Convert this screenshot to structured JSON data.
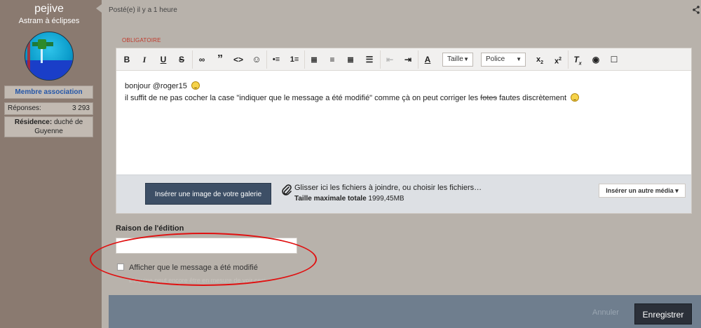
{
  "user": {
    "name": "pejive",
    "title": "Astram à éclipses",
    "badge": "Membre association",
    "replies_label": "Réponses:",
    "replies_value": "3 293",
    "residence_label": "Résidence:",
    "residence_value": "duché de Guyenne"
  },
  "post": {
    "meta": "Posté(e) il y a 1 heure"
  },
  "editor": {
    "required_label": "OBLIGATOIRE",
    "toolbar": {
      "size_select": "Taille",
      "font_select": "Police"
    },
    "content": {
      "line1": "bonjour @roger15",
      "line2_before": "il suffit de ne pas cocher la case \"indiquer que le message a été modifié\"  comme çà on peut corriger les ",
      "line2_struck": "fotes",
      "line2_after": " fautes discrètement"
    },
    "upload": {
      "gallery_button": "Insérer une image de votre galerie",
      "drop_text": "Glisser ici les fichiers à joindre, ou choisir les fichiers…",
      "max_size_label": "Taille maximale totale",
      "max_size_value": "1999,45MB",
      "media_button": "Insérer un autre média ▾"
    }
  },
  "edit_reason": {
    "label": "Raison de l'édition",
    "value": "",
    "checkbox_label": "Afficher que le message a été modifié",
    "checkbox_checked": false,
    "hint": "L'équipe peut encore être en mesure de voir ceci"
  },
  "actions": {
    "cancel": "Annuler",
    "save": "Enregistrer"
  },
  "colors": {
    "sidebar": "#8a7a70",
    "footer": "#6f7e8e",
    "save_button": "#2b3039",
    "gallery_button": "#3d4f66",
    "required_text": "#c0392b",
    "annotation_ellipse": "#e01010"
  }
}
